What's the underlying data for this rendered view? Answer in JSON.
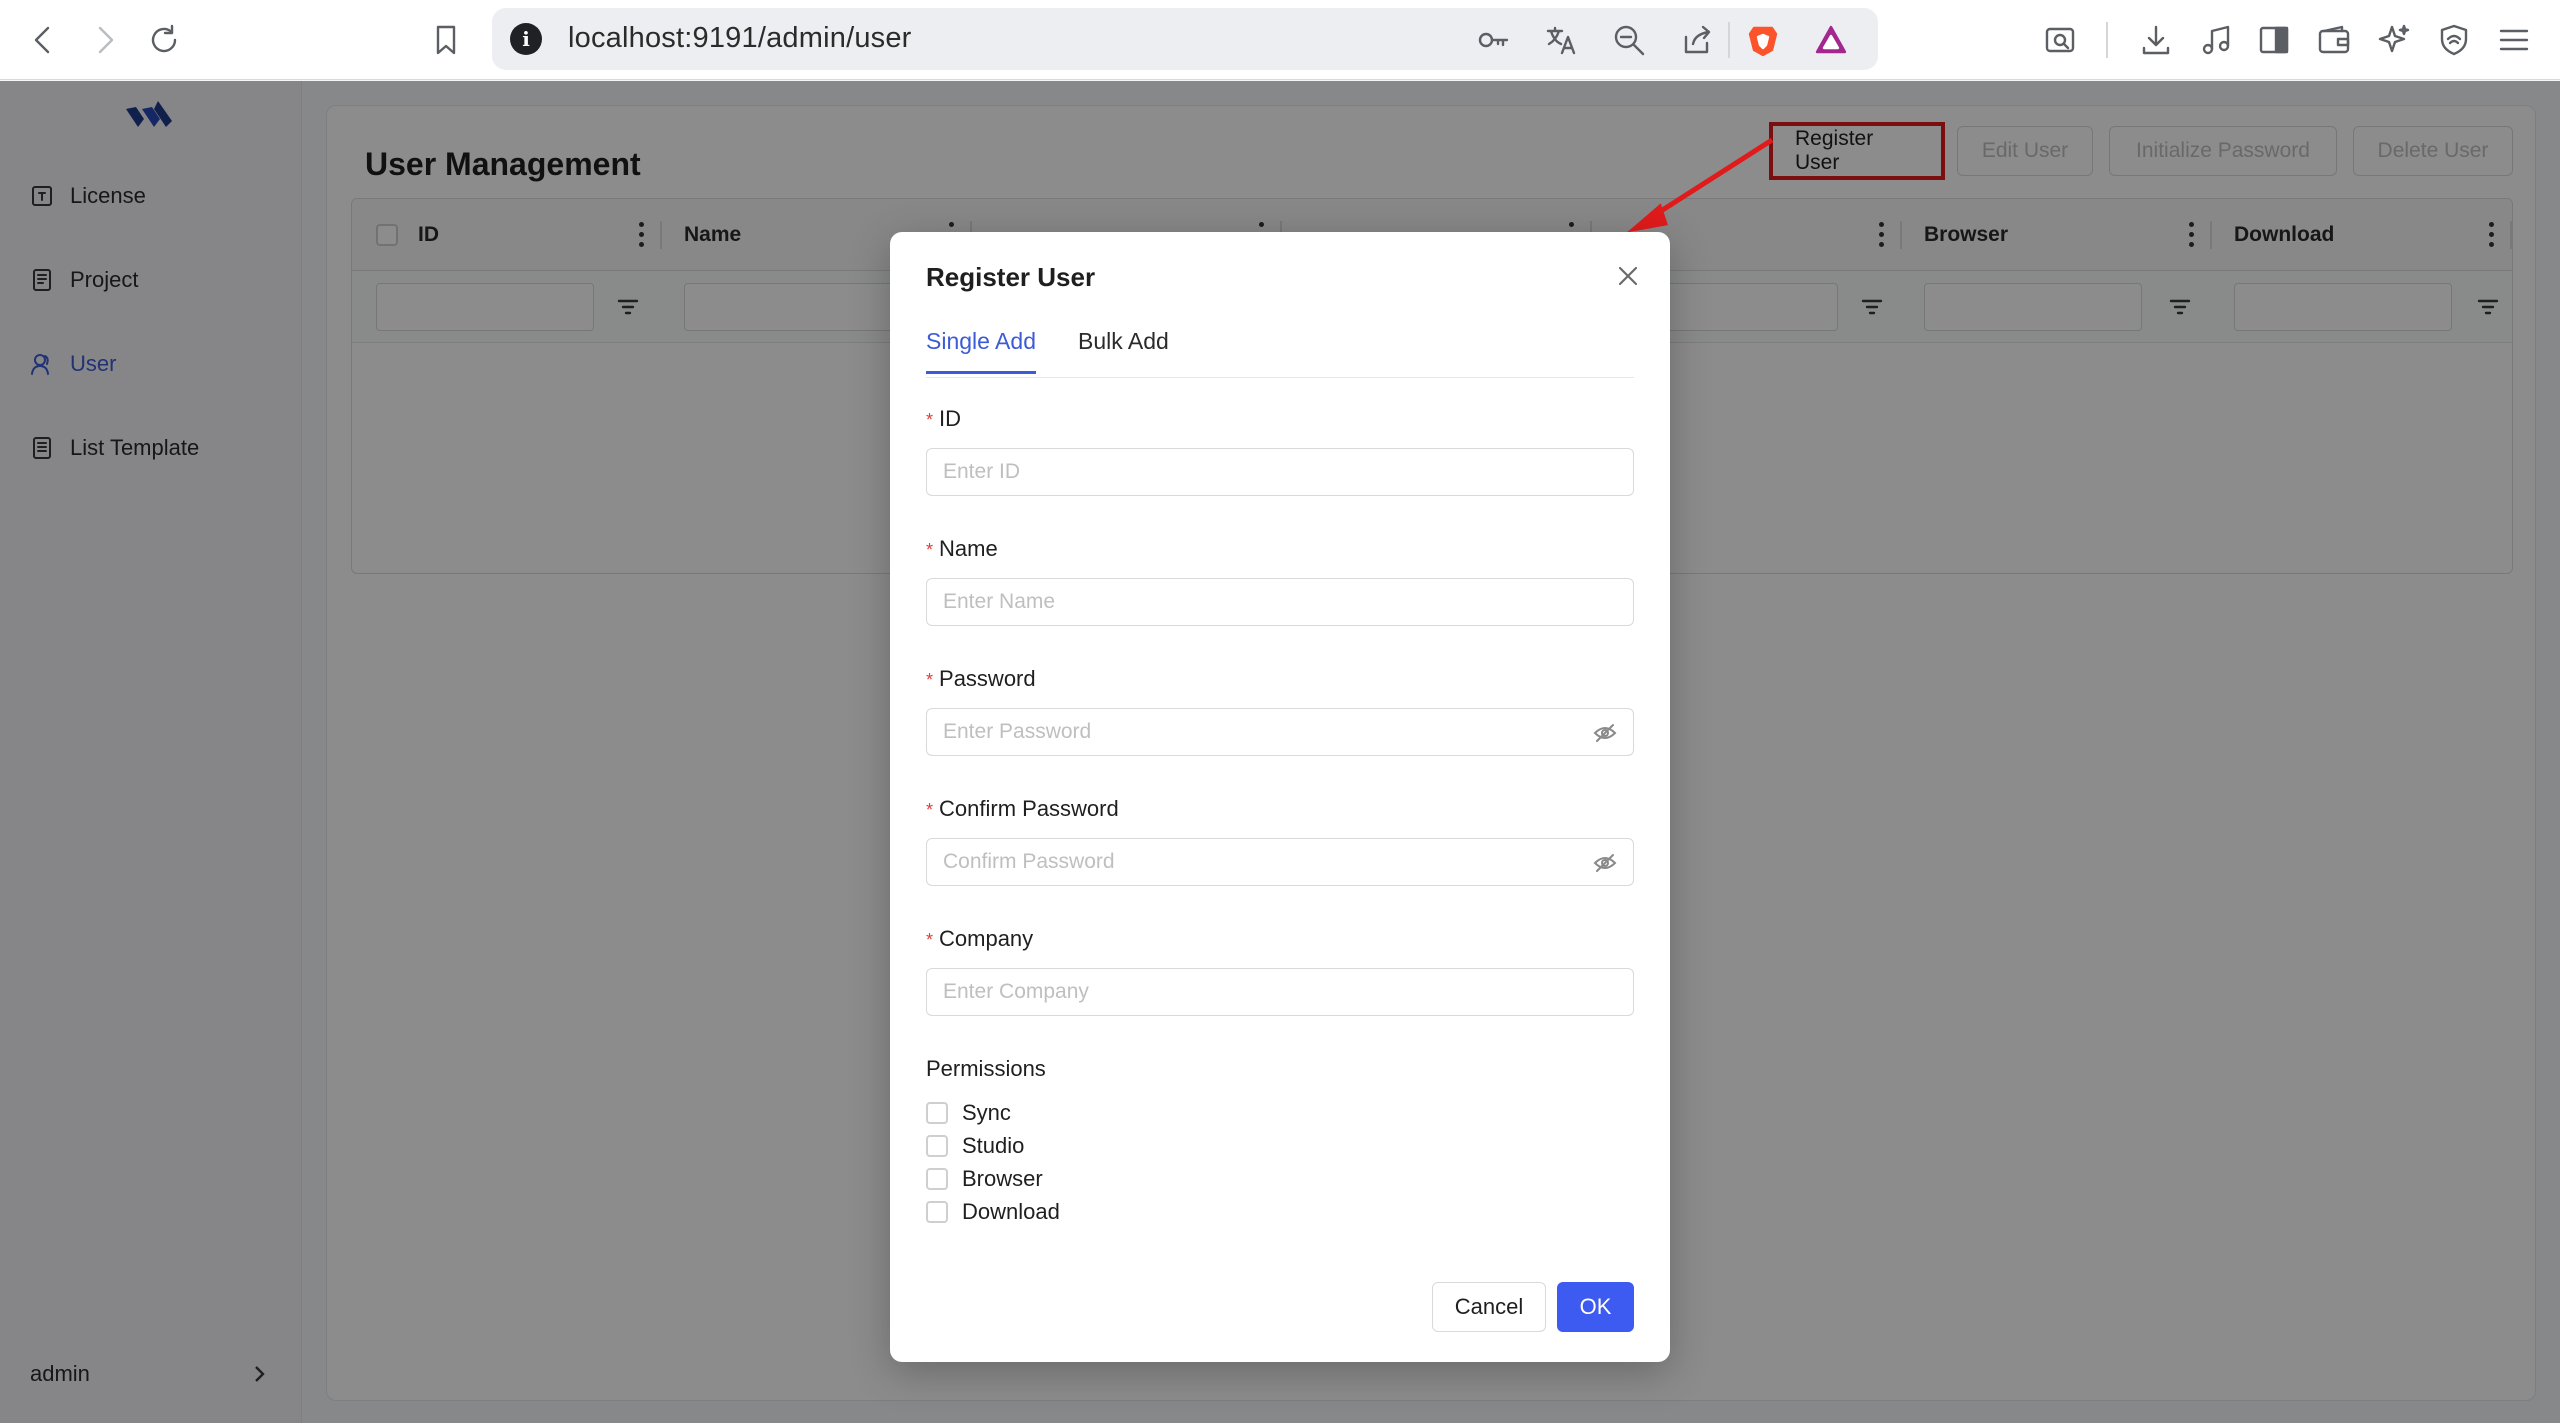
{
  "browser": {
    "url": "localhost:9191/admin/user"
  },
  "sidebar": {
    "items": [
      {
        "label": "License",
        "icon": "license-icon"
      },
      {
        "label": "Project",
        "icon": "project-icon"
      },
      {
        "label": "User",
        "icon": "user-icon",
        "active": true
      },
      {
        "label": "List Template",
        "icon": "list-template-icon"
      }
    ],
    "account": "admin"
  },
  "page": {
    "title": "User Management",
    "toolbar": {
      "register": "Register User",
      "edit": "Edit User",
      "init_password": "Initialize Password",
      "delete": "Delete User"
    },
    "columns": [
      "ID",
      "Name",
      "",
      "",
      "",
      "Browser",
      "Download"
    ]
  },
  "modal": {
    "title": "Register User",
    "tabs": [
      "Single Add",
      "Bulk Add"
    ],
    "fields": {
      "id": {
        "label": "ID",
        "placeholder": "Enter ID"
      },
      "name": {
        "label": "Name",
        "placeholder": "Enter Name"
      },
      "password": {
        "label": "Password",
        "placeholder": "Enter Password"
      },
      "confirm": {
        "label": "Confirm Password",
        "placeholder": "Confirm Password"
      },
      "company": {
        "label": "Company",
        "placeholder": "Enter Company"
      }
    },
    "permissions_label": "Permissions",
    "permissions": [
      "Sync",
      "Studio",
      "Browser",
      "Download"
    ],
    "cancel": "Cancel",
    "ok": "OK"
  },
  "colors": {
    "accent": "#3d5bd6",
    "primary_button": "#3d5bf0",
    "annotation": "#e01b1b",
    "required": "#e53935"
  }
}
